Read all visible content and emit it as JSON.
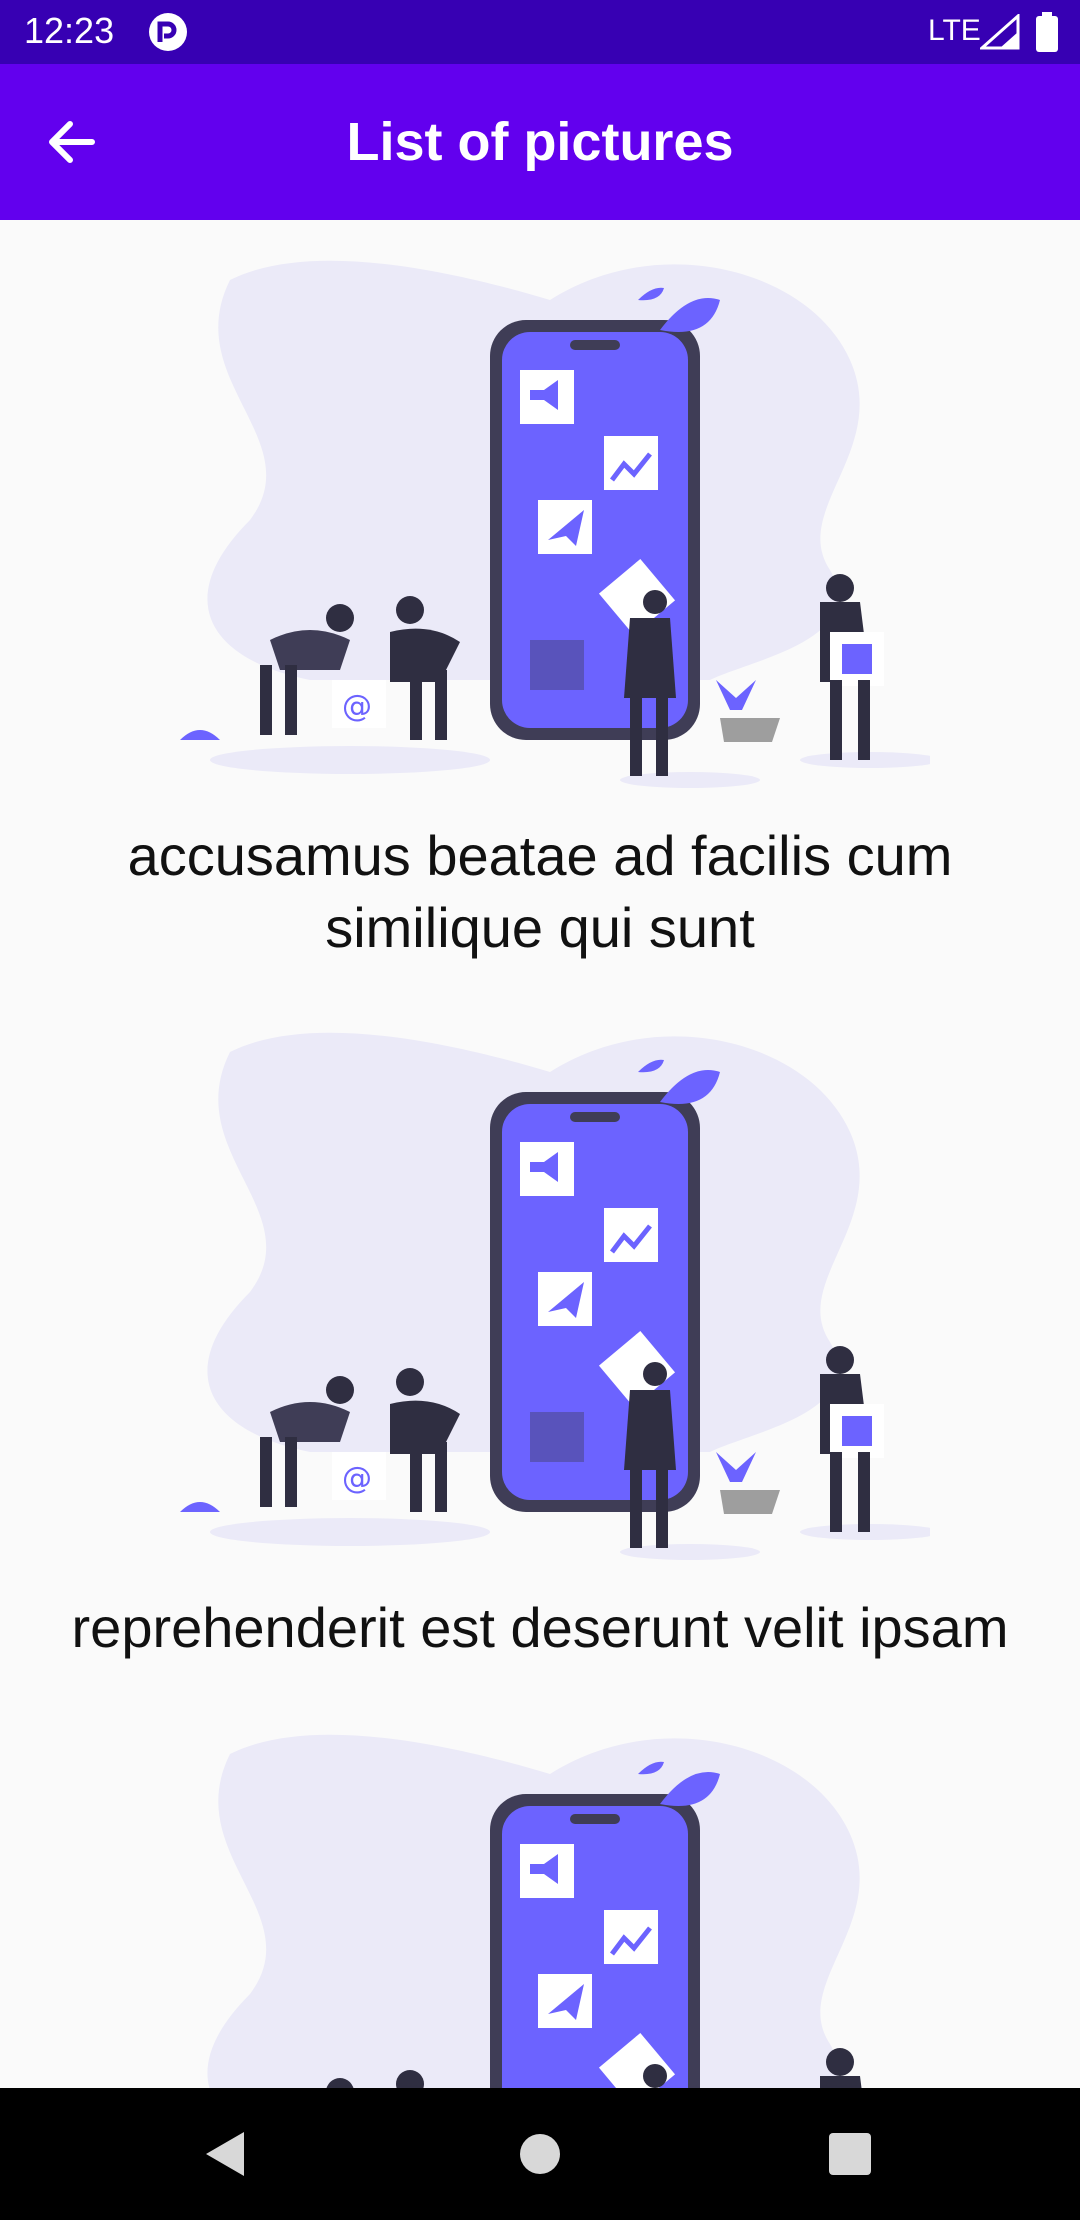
{
  "status_bar": {
    "time": "12:23",
    "network": "LTE",
    "icons": [
      "app-notification-icon",
      "signal-icon",
      "battery-icon"
    ]
  },
  "app_bar": {
    "title": "List of pictures",
    "back_icon": "arrow-back-icon"
  },
  "pictures": [
    {
      "caption": "accusamus beatae ad facilis cum similique qui sunt"
    },
    {
      "caption": "reprehenderit est deserunt velit ipsam"
    },
    {
      "caption": ""
    }
  ],
  "nav_bar": {
    "icons": [
      "back-triangle-icon",
      "home-circle-icon",
      "recents-square-icon"
    ]
  },
  "colors": {
    "status_bar": "#3700b3",
    "app_bar": "#6200ee",
    "illustration_accent": "#6c63ff",
    "illustration_blob": "#ebeaf8",
    "background": "#fafafa"
  }
}
